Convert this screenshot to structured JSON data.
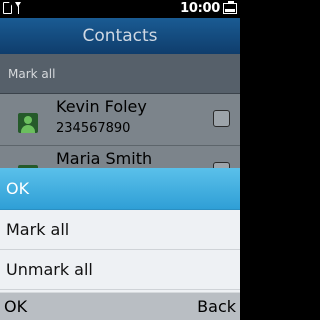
{
  "status": {
    "time": "10:00"
  },
  "app": {
    "title": "Contacts",
    "mark_all_label": "Mark all",
    "contacts": [
      {
        "name": "Kevin Foley",
        "number": "234567890"
      },
      {
        "name": "Maria Smith",
        "number": ""
      }
    ]
  },
  "menu": {
    "items": [
      {
        "label": "OK",
        "selected": true
      },
      {
        "label": "Mark all",
        "selected": false
      },
      {
        "label": "Unmark all",
        "selected": false
      }
    ]
  },
  "softkeys": {
    "left": "OK",
    "right": "Back"
  },
  "colors": {
    "selection": "#3fb0e0",
    "titlebar": "#1a5b93"
  }
}
